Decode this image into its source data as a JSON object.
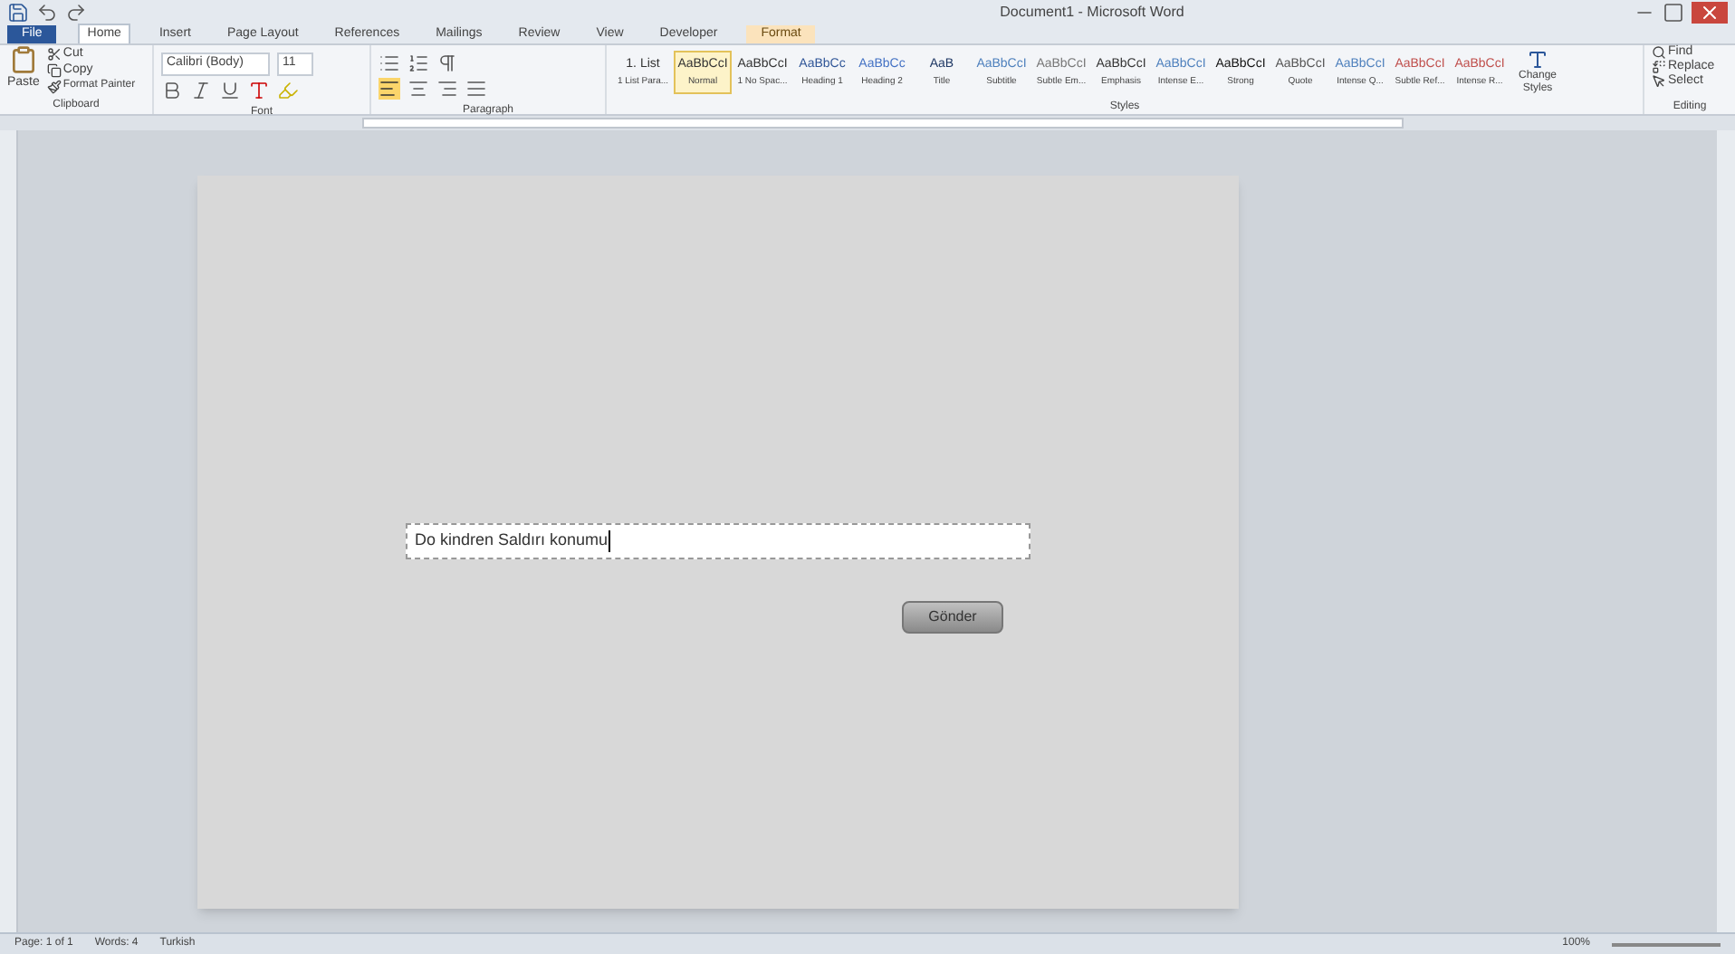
{
  "window": {
    "title": "Document1 - Microsoft Word"
  },
  "tabs": [
    {
      "label": "File",
      "selected": false,
      "kind": "file"
    },
    {
      "label": "Home",
      "selected": true,
      "kind": "tab"
    },
    {
      "label": "Insert",
      "selected": false,
      "kind": "tab"
    },
    {
      "label": "Page Layout",
      "selected": false,
      "kind": "tab"
    },
    {
      "label": "References",
      "selected": false,
      "kind": "tab"
    },
    {
      "label": "Mailings",
      "selected": false,
      "kind": "tab"
    },
    {
      "label": "Review",
      "selected": false,
      "kind": "tab"
    },
    {
      "label": "View",
      "selected": false,
      "kind": "tab"
    },
    {
      "label": "Developer",
      "selected": false,
      "kind": "tab"
    },
    {
      "label": "Format",
      "selected": false,
      "kind": "contextual"
    }
  ],
  "clipboard": {
    "paste": "Paste",
    "cut": "Cut",
    "copy": "Copy",
    "painter": "Format Painter",
    "group": "Clipboard"
  },
  "font": {
    "name": "Calibri (Body)",
    "size": "11",
    "group": "Font"
  },
  "paragraph": {
    "group": "Paragraph"
  },
  "styles": {
    "group": "Styles",
    "change": "Change Styles",
    "items": [
      {
        "sample": "1. List",
        "label": "1 List Para...",
        "selected": false,
        "color": "#333333"
      },
      {
        "sample": "AaBbCcI",
        "label": "Normal",
        "selected": true,
        "color": "#333333"
      },
      {
        "sample": "AaBbCcI",
        "label": "1 No Spac...",
        "selected": false,
        "color": "#333333"
      },
      {
        "sample": "AaBbCc",
        "label": "Heading 1",
        "selected": false,
        "color": "#2f5597"
      },
      {
        "sample": "AaBbCc",
        "label": "Heading 2",
        "selected": false,
        "color": "#4472c4"
      },
      {
        "sample": "AaB",
        "label": "Title",
        "selected": false,
        "color": "#1f3864"
      },
      {
        "sample": "AaBbCcI",
        "label": "Subtitle",
        "selected": false,
        "color": "#4f81bd"
      },
      {
        "sample": "AaBbCcI",
        "label": "Subtle Em...",
        "selected": false,
        "color": "#777777"
      },
      {
        "sample": "AaBbCcI",
        "label": "Emphasis",
        "selected": false,
        "color": "#333333"
      },
      {
        "sample": "AaBbCcI",
        "label": "Intense E...",
        "selected": false,
        "color": "#4f81bd"
      },
      {
        "sample": "AaBbCcI",
        "label": "Strong",
        "selected": false,
        "color": "#111111"
      },
      {
        "sample": "AaBbCcI",
        "label": "Quote",
        "selected": false,
        "color": "#555555"
      },
      {
        "sample": "AaBbCcI",
        "label": "Intense Q...",
        "selected": false,
        "color": "#4f81bd"
      },
      {
        "sample": "AaBbCcI",
        "label": "Subtle Ref...",
        "selected": false,
        "color": "#c0504d"
      },
      {
        "sample": "AaBbCcI",
        "label": "Intense R...",
        "selected": false,
        "color": "#c0504d"
      }
    ]
  },
  "editing": {
    "find": "Find",
    "replace": "Replace",
    "select": "Select",
    "group": "Editing"
  },
  "document": {
    "field_value": "Do kindren Saldırı konumu",
    "button": "Gönder"
  },
  "status_bar": {
    "page": "Page: 1 of 1",
    "words": "Words: 4",
    "language": "Turkish",
    "zoom": "100%"
  }
}
